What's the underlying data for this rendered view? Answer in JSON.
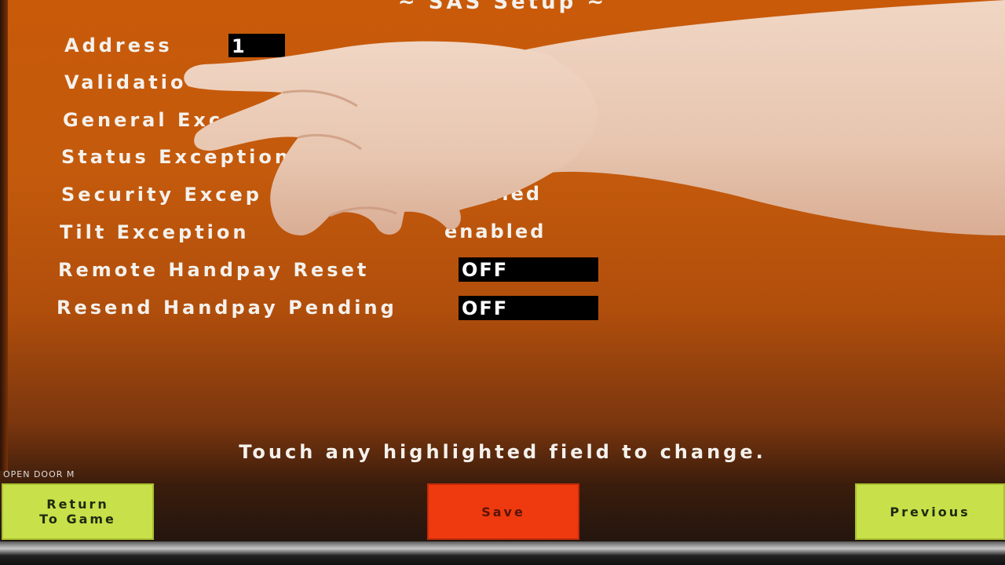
{
  "title": "~ SAS Setup ~",
  "settings": [
    {
      "label": "Address",
      "value": "1"
    },
    {
      "label": "Validatio",
      "value": ""
    },
    {
      "label": "General  Exceptio",
      "value": ""
    },
    {
      "label": "Status  Exception",
      "value": ""
    },
    {
      "label": "Security  Excep",
      "value": "abled"
    },
    {
      "label": "Tilt  Exception",
      "value": "enabled"
    },
    {
      "label": "Remote  Handpay  Reset",
      "value": "OFF"
    },
    {
      "label": "Resend  Handpay  Pending",
      "value": "OFF"
    }
  ],
  "hint": "Touch  any  highlighted  field  to  change.",
  "status_text": "OPEN  DOOR  M",
  "buttons": {
    "return_line1": "Return",
    "return_line2": "To  Game",
    "save": "Save",
    "previous": "Previous"
  },
  "colors": {
    "background": "#c45a0c",
    "field_highlight": "#000000",
    "green_button": "#c8e04a",
    "red_button": "#ee3a0e"
  }
}
